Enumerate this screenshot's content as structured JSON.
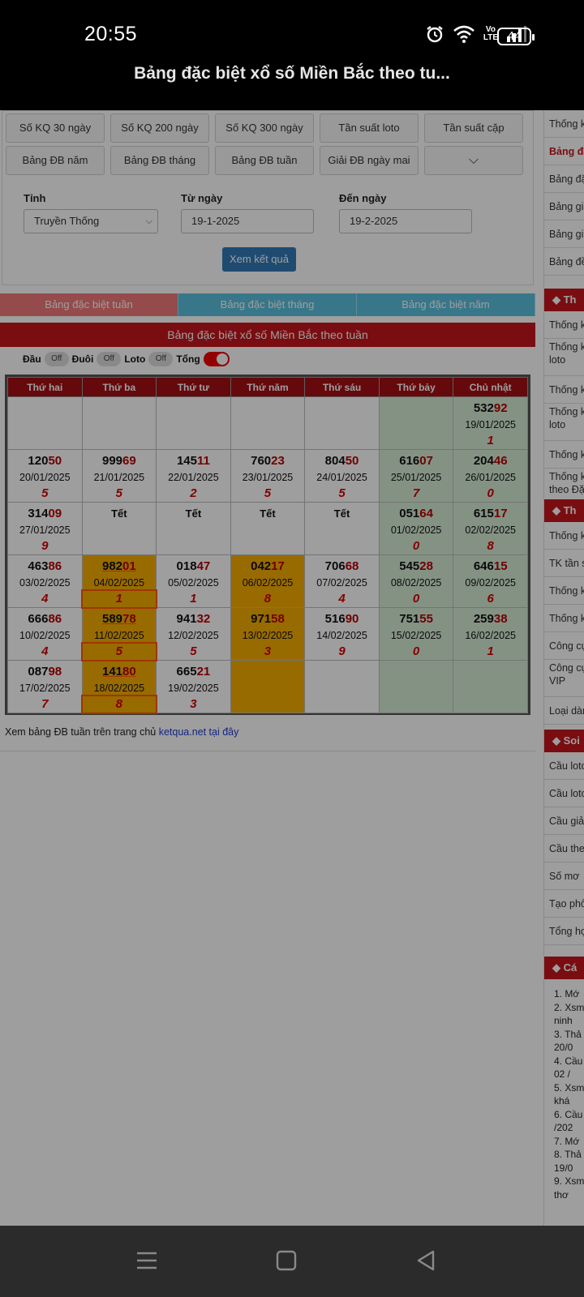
{
  "status": {
    "time": "20:55",
    "battery": "44",
    "volte": "Vo LTE"
  },
  "header": {
    "title": "Bảng đặc biệt xổ số Miền Bắc theo tu..."
  },
  "quick_buttons": [
    "Số KQ 30 ngày",
    "Số KQ 200 ngày",
    "Số KQ 300 ngày",
    "Tần suất loto",
    "Tần suất cặp",
    "Bảng ĐB năm",
    "Bảng ĐB tháng",
    "Bảng ĐB tuần",
    "Giải ĐB ngày mai",
    "⌵"
  ],
  "form": {
    "province_label": "Tỉnh",
    "province_value": "Truyền Thống",
    "from_label": "Từ ngày",
    "from_value": "19-1-2025",
    "to_label": "Đến ngày",
    "to_value": "19-2-2025",
    "submit": "Xem kết quả"
  },
  "tabs": [
    "Bảng đặc biệt tuần",
    "Bảng đặc biệt tháng",
    "Bảng đặc biệt năm"
  ],
  "banner": "Bảng đặc biệt xổ số Miền Bắc theo tuần",
  "toggles": {
    "dau": "Đầu",
    "duoi": "Đuôi",
    "loto": "Loto",
    "tong": "Tổng",
    "off": "Off"
  },
  "table": {
    "headers": [
      "Thứ hai",
      "Thứ ba",
      "Thứ tư",
      "Thứ năm",
      "Thứ sáu",
      "Thứ bảy",
      "Chủ nhật"
    ],
    "rows": [
      [
        null,
        null,
        null,
        null,
        null,
        null,
        {
          "a": "532",
          "b": "92",
          "date": "19/01/2025",
          "tot": "1"
        }
      ],
      [
        {
          "a": "120",
          "b": "50",
          "date": "20/01/2025",
          "tot": "5"
        },
        {
          "a": "999",
          "b": "69",
          "date": "21/01/2025",
          "tot": "5"
        },
        {
          "a": "145",
          "b": "11",
          "date": "22/01/2025",
          "tot": "2"
        },
        {
          "a": "760",
          "b": "23",
          "date": "23/01/2025",
          "tot": "5"
        },
        {
          "a": "804",
          "b": "50",
          "date": "24/01/2025",
          "tot": "5"
        },
        {
          "a": "616",
          "b": "07",
          "date": "25/01/2025",
          "tot": "7"
        },
        {
          "a": "204",
          "b": "46",
          "date": "26/01/2025",
          "tot": "0"
        }
      ],
      [
        {
          "a": "314",
          "b": "09",
          "date": "27/01/2025",
          "tot": "9"
        },
        {
          "tet": "Tết"
        },
        {
          "tet": "Tết"
        },
        {
          "tet": "Tết"
        },
        {
          "tet": "Tết"
        },
        {
          "a": "051",
          "b": "64",
          "date": "01/02/2025",
          "tot": "0"
        },
        {
          "a": "615",
          "b": "17",
          "date": "02/02/2025",
          "tot": "8"
        }
      ],
      [
        {
          "a": "463",
          "b": "86",
          "date": "03/02/2025",
          "tot": "4"
        },
        {
          "a": "982",
          "b": "01",
          "date": "04/02/2025",
          "tot": "1"
        },
        {
          "a": "018",
          "b": "47",
          "date": "05/02/2025",
          "tot": "1"
        },
        {
          "a": "042",
          "b": "17",
          "date": "06/02/2025",
          "tot": "8"
        },
        {
          "a": "706",
          "b": "68",
          "date": "07/02/2025",
          "tot": "4"
        },
        {
          "a": "545",
          "b": "28",
          "date": "08/02/2025",
          "tot": "0"
        },
        {
          "a": "646",
          "b": "15",
          "date": "09/02/2025",
          "tot": "6"
        }
      ],
      [
        {
          "a": "666",
          "b": "86",
          "date": "10/02/2025",
          "tot": "4"
        },
        {
          "a": "589",
          "b": "78",
          "date": "11/02/2025",
          "tot": "5"
        },
        {
          "a": "941",
          "b": "32",
          "date": "12/02/2025",
          "tot": "5"
        },
        {
          "a": "971",
          "b": "58",
          "date": "13/02/2025",
          "tot": "3"
        },
        {
          "a": "516",
          "b": "90",
          "date": "14/02/2025",
          "tot": "9"
        },
        {
          "a": "751",
          "b": "55",
          "date": "15/02/2025",
          "tot": "0"
        },
        {
          "a": "259",
          "b": "38",
          "date": "16/02/2025",
          "tot": "1"
        }
      ],
      [
        {
          "a": "087",
          "b": "98",
          "date": "17/02/2025",
          "tot": "7"
        },
        {
          "a": "141",
          "b": "80",
          "date": "18/02/2025",
          "tot": "8"
        },
        {
          "a": "665",
          "b": "21",
          "date": "19/02/2025",
          "tot": "3"
        },
        null,
        null,
        null,
        null
      ]
    ]
  },
  "footnote": {
    "text": "Xem bảng ĐB tuần trên trang chủ ",
    "link": "ketqua.net tại đây"
  },
  "sidebar": {
    "group1": [
      "Thống k",
      "Bảng đặ",
      "Bảng đặ",
      "Bảng giả",
      "Bảng giả",
      "Bảng đề"
    ],
    "head1": "Th",
    "group2": [
      "Thống k",
      "Thống k loto",
      "Thống k",
      "Thống k loto",
      "Thống k",
      "Thống k theo Đặ"
    ],
    "head2": "Th",
    "group3": [
      "Thống k",
      "TK tần s",
      "Thống k",
      "Thống k",
      "Công cụ",
      "Công cụ VIP",
      "Loại dàn"
    ],
    "head3": "Soi",
    "group4": [
      "Cầu loto",
      "Cầu loto",
      "Cầu giải",
      "Cầu theo",
      "Số mơ",
      "Tạo phô",
      "Tổng họ"
    ],
    "head4": "Cá",
    "list": [
      "1. Mớ",
      "2. Xsm",
      "ninh",
      "3. Thả",
      "20/0",
      "4. Cầu",
      "02 /",
      "5. Xsm",
      "khá",
      "6. Cầu",
      "/202",
      "7. Mớ",
      "8. Thả",
      "19/0",
      "9. Xsm",
      "thơ"
    ]
  }
}
